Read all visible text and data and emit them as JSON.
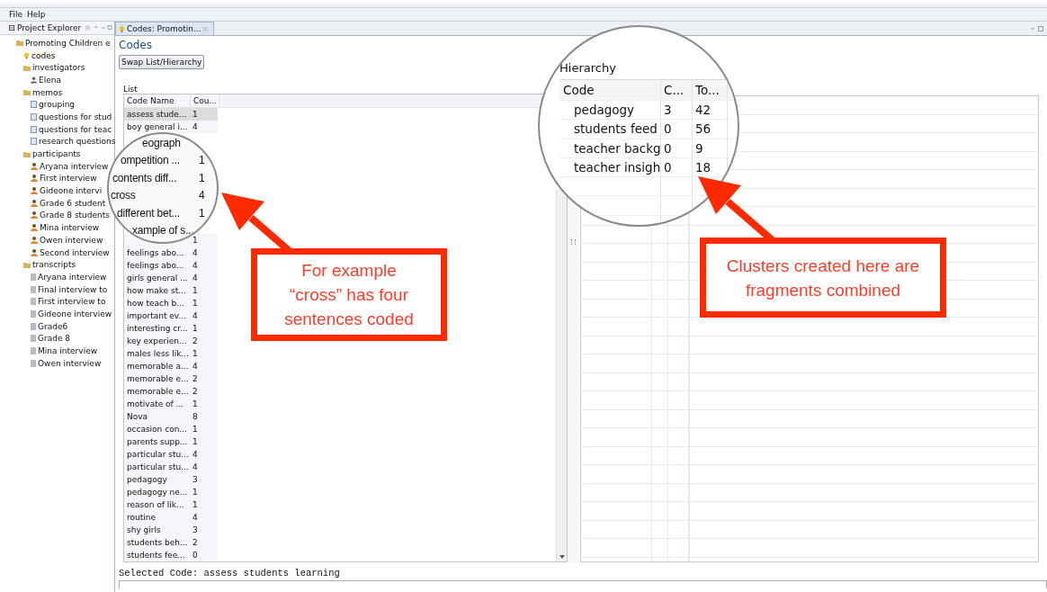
{
  "menu": [
    "File",
    "Help"
  ],
  "sidebar": {
    "title": "Project Explorer",
    "tree": [
      {
        "label": "Promoting Children e",
        "kind": "project",
        "selected": false,
        "children": [
          {
            "label": "codes",
            "kind": "codes",
            "selected": true
          },
          {
            "label": "investigators",
            "kind": "folder",
            "selected": false,
            "children": [
              {
                "label": "Elena",
                "kind": "person",
                "selected": false
              }
            ]
          },
          {
            "label": "memos",
            "kind": "folder",
            "selected": false,
            "children": [
              {
                "label": "grouping",
                "kind": "memo",
                "selected": false
              },
              {
                "label": "questions for stud",
                "kind": "memo",
                "selected": false
              },
              {
                "label": "questions for teac",
                "kind": "memo",
                "selected": false
              },
              {
                "label": "research questions",
                "kind": "memo",
                "selected": false
              }
            ]
          },
          {
            "label": "participants",
            "kind": "folder",
            "selected": false,
            "children": [
              {
                "label": "Aryana interview",
                "kind": "participant",
                "selected": false
              },
              {
                "label": "First interview",
                "kind": "participant",
                "selected": false
              },
              {
                "label": "Gideone intervi",
                "kind": "participant",
                "selected": false
              },
              {
                "label": "Grade 6 student",
                "kind": "participant",
                "selected": false
              },
              {
                "label": "Grade 8 students",
                "kind": "participant",
                "selected": false
              },
              {
                "label": "Mina interview",
                "kind": "participant",
                "selected": false
              },
              {
                "label": "Owen interview",
                "kind": "participant",
                "selected": false
              },
              {
                "label": "Second interview",
                "kind": "participant",
                "selected": false
              }
            ]
          },
          {
            "label": "transcripts",
            "kind": "folder",
            "selected": false,
            "children": [
              {
                "label": "Aryana interview",
                "kind": "transcript",
                "selected": false
              },
              {
                "label": "Final interview to",
                "kind": "transcript",
                "selected": false
              },
              {
                "label": "First interview to",
                "kind": "transcript",
                "selected": false
              },
              {
                "label": "Gideone interview",
                "kind": "transcript",
                "selected": false
              },
              {
                "label": "Grade6",
                "kind": "transcript",
                "selected": false
              },
              {
                "label": "Grade 8",
                "kind": "transcript",
                "selected": false
              },
              {
                "label": "Mina interview",
                "kind": "transcript",
                "selected": false
              },
              {
                "label": "Owen interview",
                "kind": "transcript",
                "selected": false
              }
            ]
          }
        ]
      }
    ]
  },
  "editor": {
    "tab": "Codes: Promotin...",
    "title": "Codes",
    "swap_button": "Swap List/Hierarchy",
    "list": {
      "label": "List",
      "columns": [
        "Code Name",
        "Cou..."
      ],
      "rows": [
        {
          "name": "assess stude...",
          "count": "1",
          "selected": true
        },
        {
          "name": "boy general i...",
          "count": "4",
          "selected": false
        },
        {
          "count": "1",
          "selected": false
        },
        {
          "name": "feelings abo...",
          "count": "4",
          "selected": false
        },
        {
          "name": "feelings abo...",
          "count": "4",
          "selected": false
        },
        {
          "name": "girls general ...",
          "count": "4",
          "selected": false
        },
        {
          "name": "how make st...",
          "count": "1",
          "selected": false
        },
        {
          "name": "how teach b...",
          "count": "1",
          "selected": false
        },
        {
          "name": "important ev...",
          "count": "4",
          "selected": false
        },
        {
          "name": "interesting cr...",
          "count": "1",
          "selected": false
        },
        {
          "name": "key experien...",
          "count": "2",
          "selected": false
        },
        {
          "name": "males less lik...",
          "count": "1",
          "selected": false
        },
        {
          "name": "memorable a...",
          "count": "4",
          "selected": false
        },
        {
          "name": "memorable e...",
          "count": "2",
          "selected": false
        },
        {
          "name": "memorable e...",
          "count": "2",
          "selected": false
        },
        {
          "name": "motivate of ...",
          "count": "1",
          "selected": false
        },
        {
          "name": "Nova",
          "count": "8",
          "selected": false
        },
        {
          "name": "occasion con...",
          "count": "1",
          "selected": false
        },
        {
          "name": "parents supp...",
          "count": "1",
          "selected": false
        },
        {
          "name": "particular stu...",
          "count": "4",
          "selected": false
        },
        {
          "name": "particular stu...",
          "count": "4",
          "selected": false
        },
        {
          "name": "pedagogy",
          "count": "3",
          "selected": false
        },
        {
          "name": "pedagogy ne...",
          "count": "1",
          "selected": false
        },
        {
          "name": "reason of lik...",
          "count": "1",
          "selected": false
        },
        {
          "name": "routine",
          "count": "4",
          "selected": false
        },
        {
          "name": "shy girls",
          "count": "3",
          "selected": false
        },
        {
          "name": "students beh...",
          "count": "2",
          "selected": false
        },
        {
          "name": "students fee...",
          "count": "0",
          "selected": false
        }
      ]
    },
    "selected_code": "Selected Code: assess students learning"
  },
  "list_magnifier": [
    {
      "name": "eograph"
    },
    {
      "name": "ompetition ...",
      "count": "1"
    },
    {
      "name": "contents diff...",
      "count": "1"
    },
    {
      "name": "cross",
      "count": "4"
    },
    {
      "name": "different bet...",
      "count": "1"
    },
    {
      "name": "xample of s..."
    }
  ],
  "hierarchy_magnifier": {
    "label": "Hierarchy",
    "columns": [
      "Code",
      "C...",
      "To..."
    ],
    "rows": [
      {
        "code": "pedagogy",
        "c": "3",
        "total": "42"
      },
      {
        "code": "students feed",
        "c": "0",
        "total": "56"
      },
      {
        "code": "teacher backg",
        "c": "0",
        "total": "9"
      },
      {
        "code": "teacher insigh",
        "c": "0",
        "total": "18"
      }
    ]
  },
  "callouts": [
    {
      "text": "For example “cross” has four sentences coded"
    },
    {
      "text": "Clusters created here are fragments combined"
    }
  ]
}
